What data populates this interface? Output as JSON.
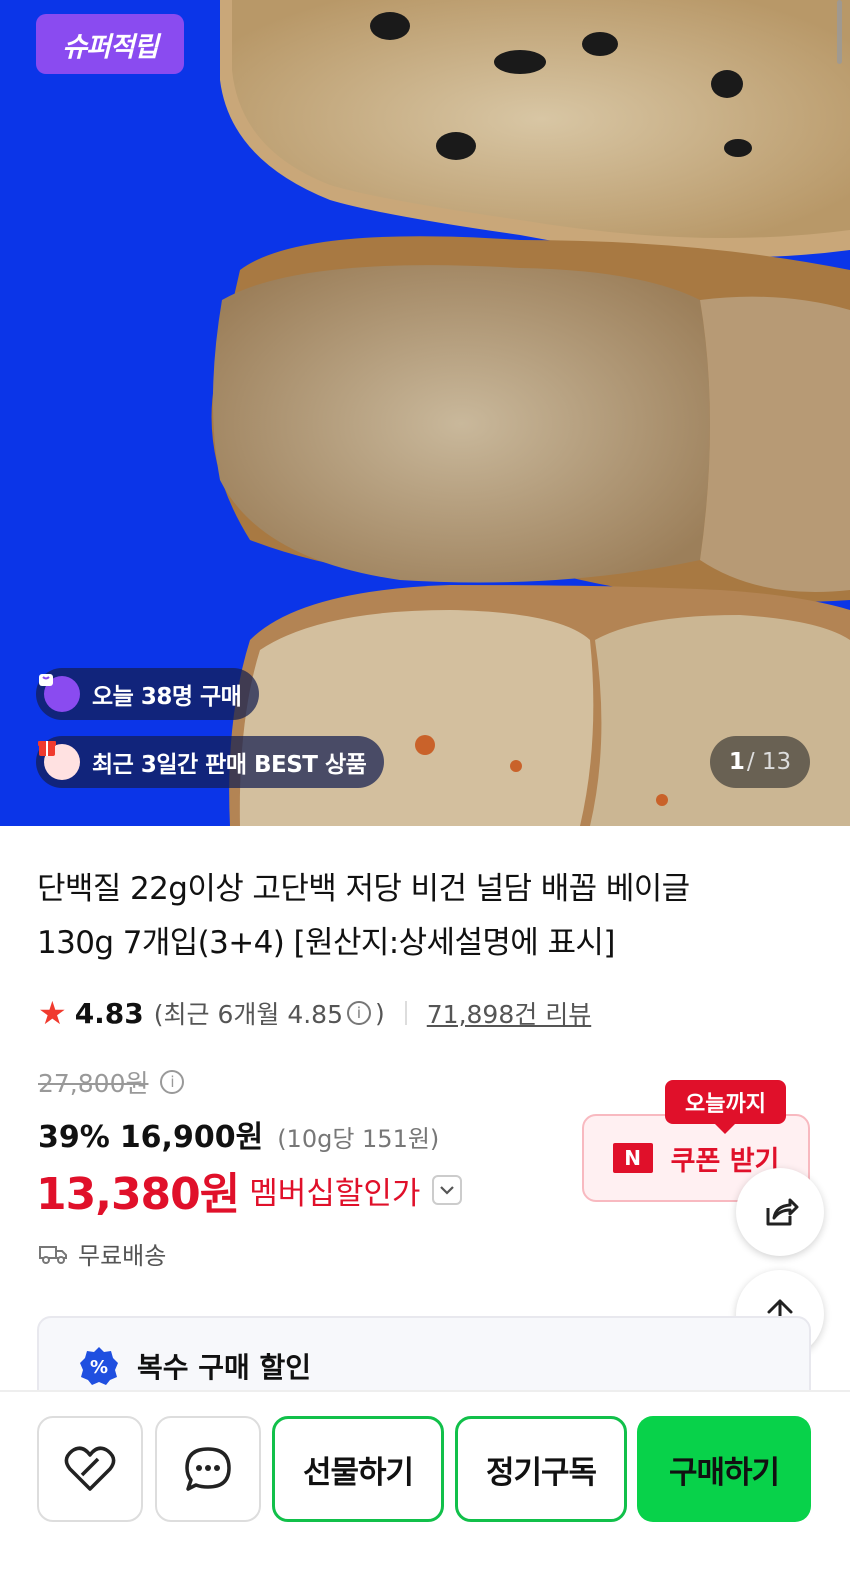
{
  "hero": {
    "badge": "슈퍼적립",
    "today_buyers": "오늘 38명 구매",
    "best_badge": "최근 3일간 판매 BEST 상품",
    "pager_current": "1",
    "pager_total": "/ 13",
    "background_color": "#0b35e8"
  },
  "product": {
    "title_line1": "단백질 22g이상 고단백 저당 비건 널담 배꼽 베이글",
    "title_line2": "130g 7개입(3+4) [원산지:상세설명에 표시]",
    "rating": "4.83",
    "recent_rating_prefix": "(최근 6개월 4.85",
    "recent_rating_suffix": ")",
    "review_count": "71,898건 리뷰"
  },
  "pricing": {
    "original_price": "27,800원",
    "discount_pct": "39%",
    "sale_price": "16,900원",
    "unit_price": "(10g당 151원)",
    "member_price": "13,380원",
    "member_label": "멤버십할인가",
    "shipping": "무료배송",
    "accent_color": "#e0102a"
  },
  "coupon": {
    "tag": "오늘까지",
    "logo": "N",
    "label": "쿠폰 받기"
  },
  "multi_discount": {
    "icon": "%",
    "title": "복수 구매 할인"
  },
  "bottom_bar": {
    "gift": "선물하기",
    "subscribe": "정기구독",
    "buy": "구매하기",
    "buy_color": "#08d24a"
  },
  "icons": {
    "like": "heart-icon",
    "talk": "chat-bubble-icon",
    "share": "share-icon",
    "top": "arrow-up-icon",
    "shipping": "truck-icon"
  }
}
